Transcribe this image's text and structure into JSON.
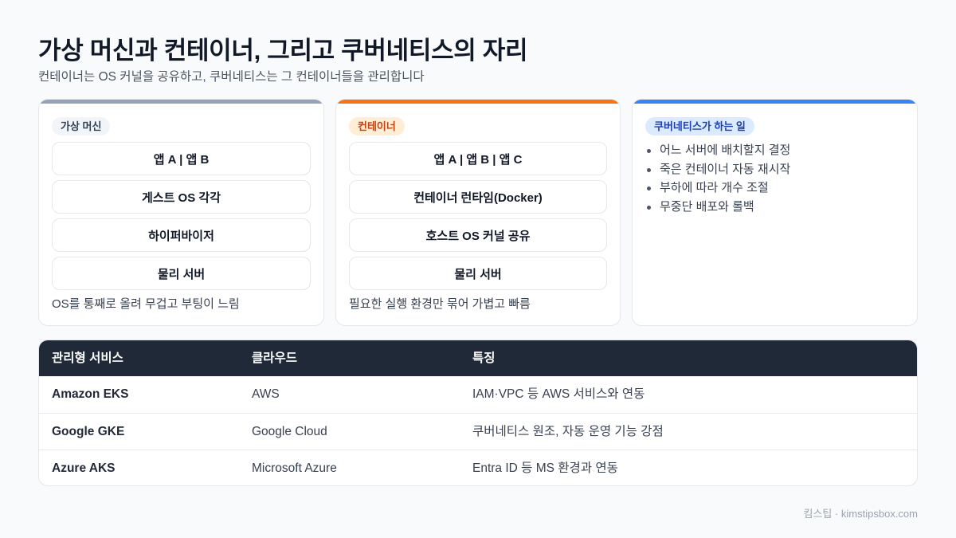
{
  "title": "가상 머신과 컨테이너, 그리고 쿠버네티스의 자리",
  "subtitle": "컨테이너는 OS 커널을 공유하고, 쿠버네티스는 그 컨테이너들을 관리합니다",
  "vm": {
    "tag": "가상 머신",
    "layers": [
      "앱 A | 앱 B",
      "게스트 OS 각각",
      "하이퍼바이저",
      "물리 서버"
    ],
    "note": "OS를 통째로 올려 무겁고 부팅이 느림",
    "color": "#94a3b8"
  },
  "container": {
    "tag": "컨테이너",
    "layers": [
      "앱 A | 앱 B | 앱 C",
      "컨테이너 런타임(Docker)",
      "호스트 OS 커널 공유",
      "물리 서버"
    ],
    "note": "필요한 실행 환경만 묶어 가볍고 빠름",
    "color": "#f97316"
  },
  "k8s": {
    "tag": "쿠버네티스가 하는 일",
    "items": [
      "어느 서버에 배치할지 결정",
      "죽은 컨테이너 자동 재시작",
      "부하에 따라 개수 조절",
      "무중단 배포와 롤백"
    ],
    "color": "#3b82f6"
  },
  "table": {
    "headers": [
      "관리형 서비스",
      "클라우드",
      "특징"
    ],
    "rows": [
      [
        "Amazon EKS",
        "AWS",
        "IAM·VPC 등 AWS 서비스와 연동"
      ],
      [
        "Google GKE",
        "Google Cloud",
        "쿠버네티스 원조, 자동 운영 기능 강점"
      ],
      [
        "Azure AKS",
        "Microsoft Azure",
        "Entra ID 등 MS 환경과 연동"
      ]
    ]
  },
  "footer": "킴스팁 · kimstipsbox.com"
}
